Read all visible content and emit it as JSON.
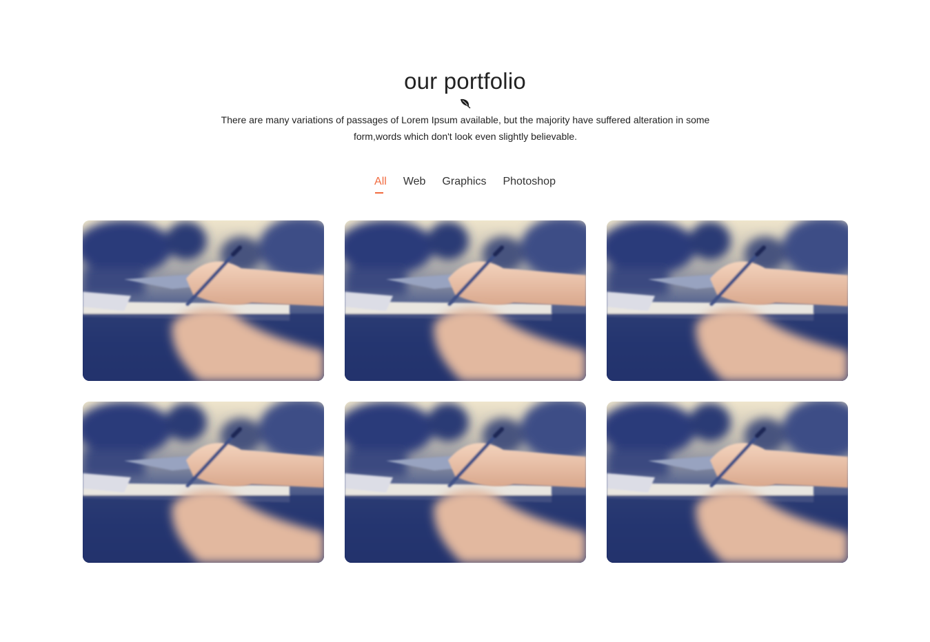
{
  "portfolio": {
    "title": "our portfolio",
    "description": "There are many variations of passages of Lorem Ipsum available, but the majority have suffered alteration in some form,words which don't look even slightly believable.",
    "decor_icon": "leaf-icon",
    "accent_color": "#f16b3f",
    "filters": [
      {
        "label": "All",
        "active": true
      },
      {
        "label": "Web",
        "active": false
      },
      {
        "label": "Graphics",
        "active": false
      },
      {
        "label": "Photoshop",
        "active": false
      }
    ],
    "items": [
      {
        "image": "hand-writing-photo"
      },
      {
        "image": "hand-writing-photo"
      },
      {
        "image": "hand-writing-photo"
      },
      {
        "image": "hand-writing-photo"
      },
      {
        "image": "hand-writing-photo"
      },
      {
        "image": "hand-writing-photo"
      }
    ]
  }
}
